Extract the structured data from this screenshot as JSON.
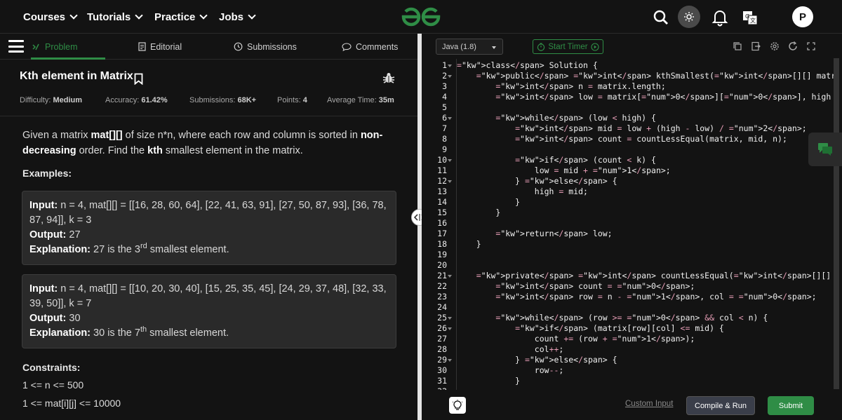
{
  "topbar": {
    "nav": [
      "Courses",
      "Tutorials",
      "Practice",
      "Jobs"
    ],
    "avatar_letter": "P",
    "icons": [
      "search-icon",
      "theme-toggle-icon",
      "bell-icon",
      "translate-icon"
    ]
  },
  "tabs": {
    "problem": "Problem",
    "editorial": "Editorial",
    "submissions": "Submissions",
    "comments": "Comments"
  },
  "problem": {
    "title": "Kth element in Matrix",
    "meta": {
      "difficulty_label": "Difficulty:",
      "difficulty": "Medium",
      "accuracy_label": "Accuracy:",
      "accuracy": "61.42%",
      "submissions_label": "Submissions:",
      "submissions": "68K+",
      "points_label": "Points:",
      "points": "4",
      "avgtime_label": "Average Time:",
      "avgtime": "35m"
    },
    "desc_parts": [
      "Given a matrix ",
      "mat[][]",
      " of size n*n, where each row and column is sorted in ",
      "non-decreasing",
      " order. Find the ",
      "kth",
      " smallest element in the matrix."
    ],
    "examples_heading": "Examples:",
    "input_label": "Input:",
    "output_label": "Output:",
    "explanation_label": "Explanation:",
    "examples": [
      {
        "input": "n = 4, mat[][] = [[16, 28, 60, 64], [22, 41, 63, 91], [27, 50, 87, 93], [36, 78, 87, 94]], k = 3",
        "output": "27",
        "expl_pre": "27 is the 3",
        "expl_sup": "rd",
        "expl_post": " smallest element."
      },
      {
        "input": "n = 4, mat[][] = [[10, 20, 30, 40], [15, 25, 35, 45], [24, 29, 37, 48], [32, 33, 39, 50]], k = 7",
        "output": "30",
        "expl_pre": "30 is the 7",
        "expl_sup": "th",
        "expl_post": " smallest element."
      }
    ],
    "constraints_heading": "Constraints:",
    "constraints": [
      "1 <= n <= 500",
      "1 <= mat[i][j] <= 10000"
    ]
  },
  "editor": {
    "language": "Java (1.8)",
    "start_timer": "Start Timer",
    "code_lines": [
      "class Solution {",
      "    public int kthSmallest(int[][] matrix, int k) {",
      "        int n = matrix.length;",
      "        int low = matrix[0][0], high = matrix[n - 1][n - 1];",
      "",
      "        while (low < high) {",
      "            int mid = low + (high - low) / 2;",
      "            int count = countLessEqual(matrix, mid, n);",
      "",
      "            if (count < k) {",
      "                low = mid + 1;",
      "            } else {",
      "                high = mid;",
      "            }",
      "        }",
      "",
      "        return low;",
      "    }",
      "",
      "",
      "    private int countLessEqual(int[][] matrix, int mid, int n) {",
      "        int count = 0;",
      "        int row = n - 1, col = 0;",
      "",
      "        while (row >= 0 && col < n) {",
      "            if (matrix[row][col] <= mid) {",
      "                count += (row + 1);",
      "                col++;",
      "            } else {",
      "                row--;",
      "            }"
    ],
    "fold_lines": [
      1,
      2,
      6,
      10,
      12,
      21,
      25,
      26,
      29
    ],
    "last_partial_line": "32"
  },
  "bottom": {
    "custom_input": "Custom Input",
    "compile_run": "Compile & Run",
    "submit": "Submit"
  },
  "colors": {
    "accent": "#2f8d46",
    "keyword": "#e59cb5",
    "bg": "#131313"
  }
}
